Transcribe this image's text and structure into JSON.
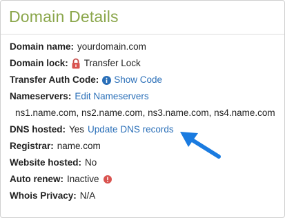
{
  "panel": {
    "title": "Domain Details"
  },
  "rows": {
    "domain_name": {
      "label": "Domain name:",
      "value": "yourdomain.com"
    },
    "domain_lock": {
      "label": "Domain lock:",
      "icon": "lock-icon",
      "value": "Transfer Lock"
    },
    "transfer_auth": {
      "label": "Transfer Auth Code:",
      "icon": "info-icon",
      "link": "Show Code"
    },
    "nameservers": {
      "label": "Nameservers:",
      "link": "Edit Nameservers",
      "value": "ns1.name.com, ns2.name.com, ns3.name.com, ns4.name.com"
    },
    "dns_hosted": {
      "label": "DNS hosted:",
      "value": "Yes",
      "link": "Update DNS records"
    },
    "registrar": {
      "label": "Registrar:",
      "value": "name.com"
    },
    "website_hosted": {
      "label": "Website hosted:",
      "value": "No"
    },
    "auto_renew": {
      "label": "Auto renew:",
      "value": "Inactive",
      "icon": "warning-icon"
    },
    "whois_privacy": {
      "label": "Whois Privacy:",
      "value": "N/A"
    }
  },
  "colors": {
    "title": "#8aa64a",
    "link": "#2a6fb8",
    "lock": "#d9534f",
    "info": "#2a6fb8",
    "warning": "#d9534f",
    "arrow": "#1a7be0"
  }
}
